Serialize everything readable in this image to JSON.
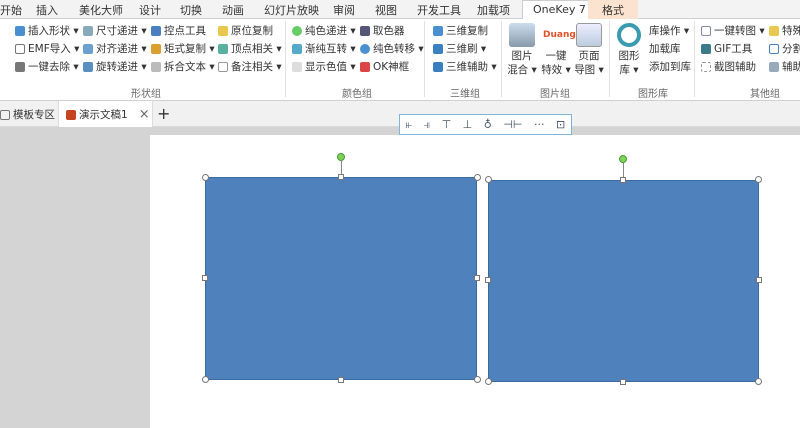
{
  "menu_tabs": [
    "开始",
    "插入",
    "美化大师",
    "设计",
    "切换",
    "动画",
    "幻灯片放映",
    "审阅",
    "视图",
    "开发工具",
    "加载项",
    "OneKey 7",
    "格式"
  ],
  "ribbon": {
    "shape_group": {
      "label": "形状组",
      "items": [
        "插入形状 ▾",
        "EMF导入 ▾",
        "一键去除 ▾",
        "尺寸递进 ▾",
        "对齐递进 ▾",
        "旋转递进 ▾",
        "控点工具",
        "矩式复制 ▾",
        "拆合文本 ▾",
        "原位复制",
        "顶点相关 ▾",
        "备注相关 ▾"
      ]
    },
    "color_group": {
      "label": "颜色组",
      "items": [
        "纯色递进 ▾",
        "渐纯互转 ▾",
        "显示色值 ▾",
        "取色器",
        "纯色转移 ▾",
        "OK神框"
      ]
    },
    "threed_group": {
      "label": "三维组",
      "items": [
        "三维复制",
        "三维刷 ▾",
        "三维辅助 ▾"
      ]
    },
    "picture_group": {
      "label": "图片组",
      "items": [
        "图片\n混合 ▾",
        "一键\n特效 ▾",
        "页面\n导图 ▾"
      ],
      "duang": "Duang"
    },
    "library_group": {
      "label": "图形库",
      "big": "图形\n库 ▾",
      "items": [
        "库操作 ▾",
        "加载库",
        "添加到库"
      ]
    },
    "other_group": {
      "label": "其他组",
      "items": [
        "一键转图 ▾",
        "GIF工具",
        "截图辅助",
        "特殊",
        "分割",
        "辅助"
      ]
    }
  },
  "doc_tabs": {
    "home": "模板专区",
    "doc": "演示文稿1",
    "close": "×",
    "add": "+"
  },
  "align_toolbar": [
    "左对齐",
    "右对齐",
    "顶对齐",
    "底对齐",
    "水平居中",
    "垂直居中",
    "更多",
    "分布"
  ],
  "colors": {
    "shape": "#4f81bd",
    "accent": "#c55a11"
  }
}
